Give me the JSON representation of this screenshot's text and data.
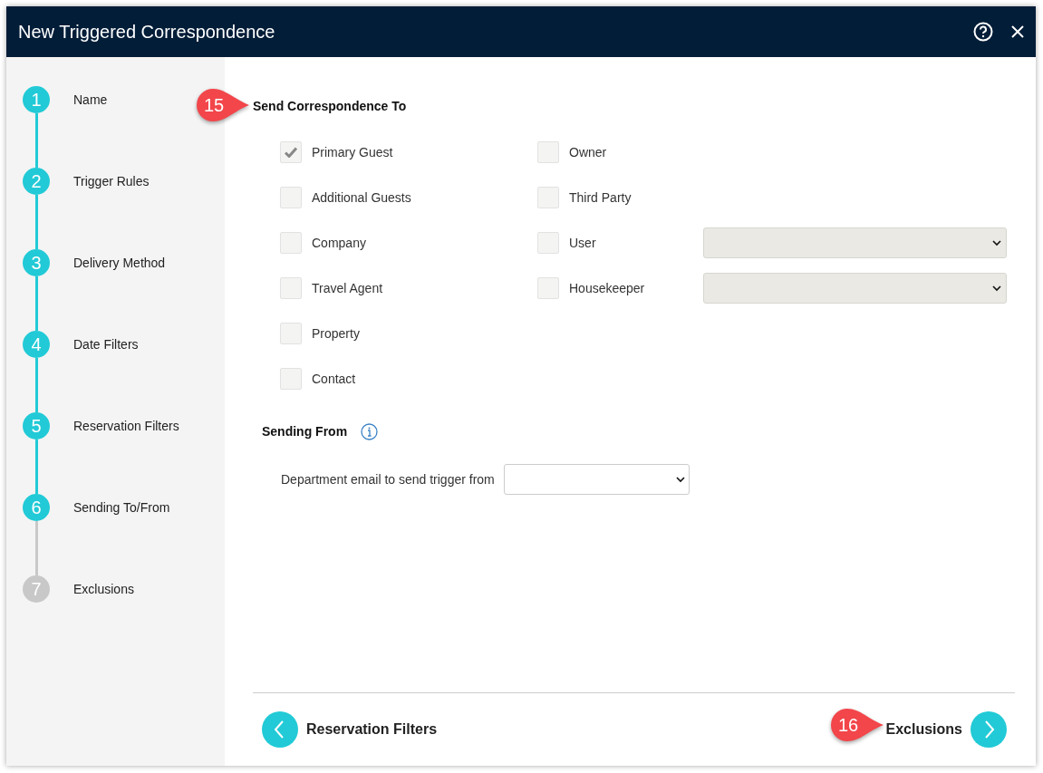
{
  "window": {
    "title": "New Triggered Correspondence"
  },
  "steps": [
    {
      "number": "1",
      "label": "Name",
      "reached": true
    },
    {
      "number": "2",
      "label": "Trigger Rules",
      "reached": true
    },
    {
      "number": "3",
      "label": "Delivery Method",
      "reached": true
    },
    {
      "number": "4",
      "label": "Date Filters",
      "reached": true
    },
    {
      "number": "5",
      "label": "Reservation Filters",
      "reached": true
    },
    {
      "number": "6",
      "label": "Sending To/From",
      "reached": true
    },
    {
      "number": "7",
      "label": "Exclusions",
      "reached": false
    }
  ],
  "send_to": {
    "heading": "Send Correspondence To",
    "left_options": [
      {
        "kind": "checkbox",
        "label": "Primary Guest",
        "checked": true
      },
      {
        "kind": "checkbox",
        "label": "Additional Guests",
        "checked": false
      },
      {
        "kind": "checkbox",
        "label": "Company",
        "checked": false
      },
      {
        "kind": "checkbox",
        "label": "Travel Agent",
        "checked": false
      },
      {
        "kind": "checkbox",
        "label": "Property",
        "checked": false
      },
      {
        "kind": "checkbox",
        "label": "Contact",
        "checked": false
      }
    ],
    "right_options": [
      {
        "kind": "checkbox",
        "label": "Owner",
        "checked": false
      },
      {
        "kind": "checkbox",
        "label": "Third Party",
        "checked": false
      },
      {
        "kind": "checkbox_select",
        "label": "User",
        "checked": false
      },
      {
        "kind": "checkbox_select",
        "label": "Housekeeper",
        "checked": false
      }
    ]
  },
  "sending_from": {
    "heading": "Sending From",
    "field_label": "Department email to send trigger from"
  },
  "footer": {
    "back": "Reservation Filters",
    "next": "Exclusions"
  },
  "callouts": [
    {
      "kind": "heading",
      "number": "15"
    },
    {
      "kind": "next",
      "number": "16"
    }
  ]
}
